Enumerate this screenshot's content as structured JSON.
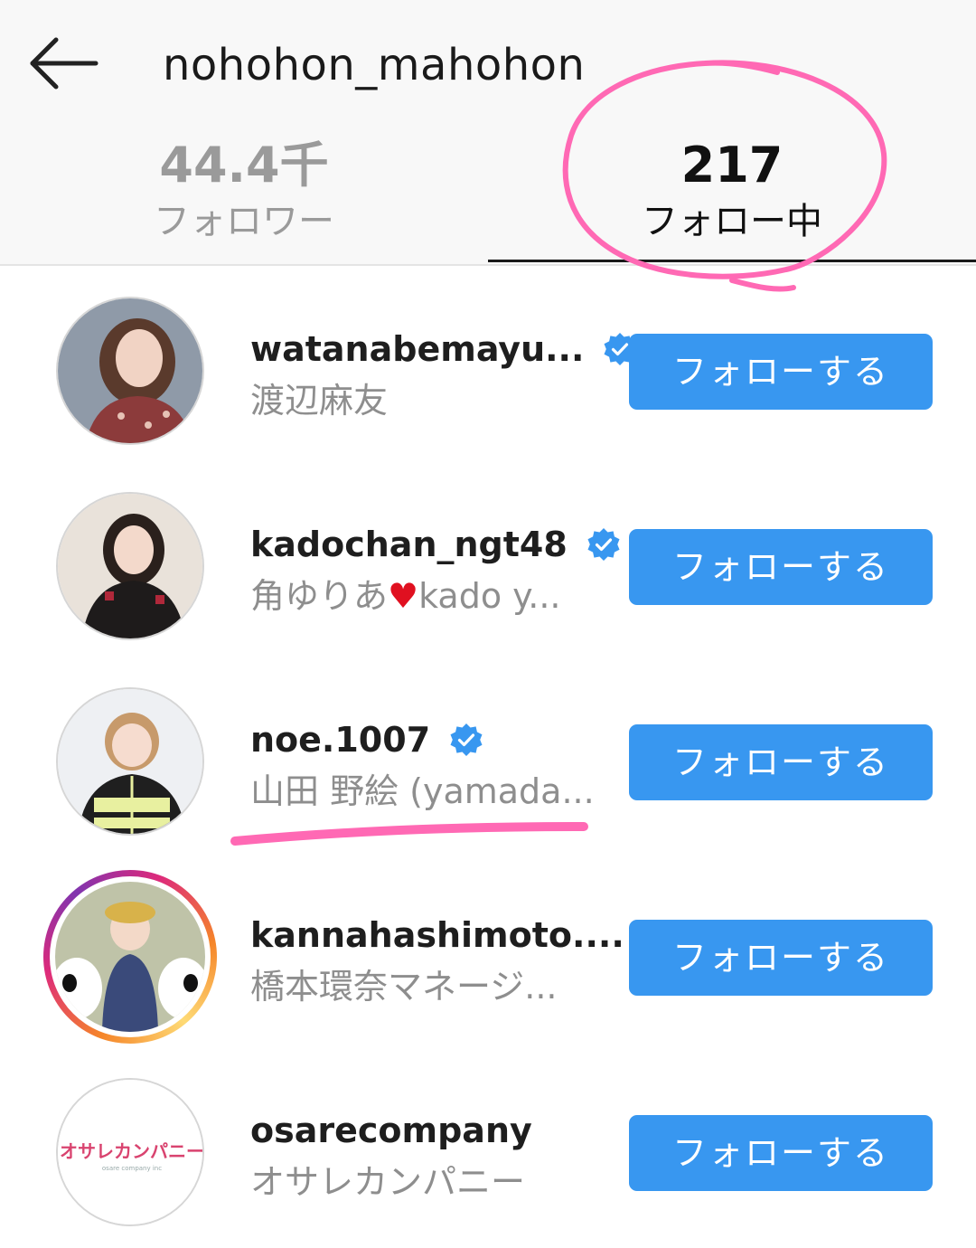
{
  "header": {
    "username": "nohohon_mahohon",
    "back_icon": "arrow-left-icon",
    "tabs": [
      {
        "count": "44.4千",
        "label": "フォロワー",
        "active": false
      },
      {
        "count": "217",
        "label": "フォロー中",
        "active": true
      }
    ]
  },
  "follow_label": "フォローする",
  "colors": {
    "follow_button": "#3897f0",
    "verified_badge": "#3897f0",
    "annotation": "#ff69b4",
    "heart": "#e01020"
  },
  "users": [
    {
      "username": "watanabemayu...",
      "full_name": "渡辺麻友",
      "verified": true,
      "story_ring": false
    },
    {
      "username": "kadochan_ngt48",
      "full_name_before": "角ゆりあ",
      "full_name_emoji": "♥",
      "full_name_after": "kado y...",
      "verified": true,
      "story_ring": false
    },
    {
      "username": "noe.1007",
      "full_name": "山田 野絵 (yamada...",
      "verified": true,
      "story_ring": false
    },
    {
      "username": "kannahashimoto....",
      "full_name": "橋本環奈マネージ...",
      "verified": false,
      "story_ring": true
    },
    {
      "username": "osarecompany",
      "full_name": "オサレカンパニー",
      "verified": false,
      "story_ring": false,
      "avatar_text": "オサレカンパニー",
      "avatar_subtext": "osare company inc"
    }
  ]
}
